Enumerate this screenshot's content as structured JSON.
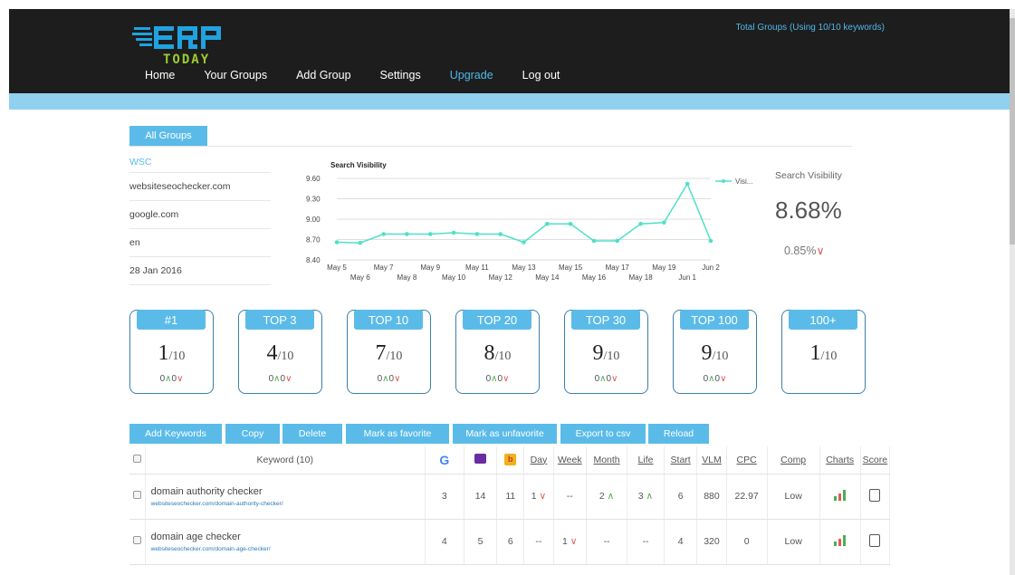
{
  "header": {
    "total_groups": "Total Groups (Using 10/10 keywords)",
    "nav": [
      "Home",
      "Your Groups",
      "Add Group",
      "Settings",
      "Upgrade",
      "Log out"
    ]
  },
  "logo": {
    "text_top": "ERP",
    "text_bottom": "TODAY",
    "brand_color": "#1fa3e0",
    "accent_color": "#9acd32"
  },
  "tabs": {
    "all_groups": "All Groups"
  },
  "group_info": {
    "name": "WSC",
    "domain": "websiteseochecker.com",
    "engine": "google.com",
    "language": "en",
    "date": "28 Jan 2016"
  },
  "chart_data": {
    "type": "line",
    "title": "Search Visibility",
    "legend": "Visi...",
    "ylim": [
      8.4,
      9.6
    ],
    "yticks": [
      "9.60",
      "9.30",
      "9.00",
      "8.70",
      "8.40"
    ],
    "x": [
      "May 5",
      "May 6",
      "May 7",
      "May 8",
      "May 9",
      "May 10",
      "May 11",
      "May 12",
      "May 13",
      "May 14",
      "May 15",
      "May 16",
      "May 17",
      "May 18",
      "May 19",
      "Jun 1",
      "Jun 2"
    ],
    "series": [
      {
        "name": "Visi...",
        "values": [
          8.66,
          8.65,
          8.78,
          8.78,
          8.78,
          8.8,
          8.78,
          8.78,
          8.66,
          8.93,
          8.93,
          8.68,
          8.68,
          8.93,
          8.95,
          9.52,
          8.68
        ]
      }
    ],
    "color": "#4fe0c8",
    "legend_position": "top-right"
  },
  "visibility": {
    "label": "Search Visibility",
    "value": "8.68%",
    "delta": "0.85%",
    "delta_arrow": "∨"
  },
  "cards": [
    {
      "title": "#1",
      "value": "1",
      "total": "/10",
      "up": "0",
      "down": "0"
    },
    {
      "title": "TOP 3",
      "value": "4",
      "total": "/10",
      "up": "0",
      "down": "0"
    },
    {
      "title": "TOP 10",
      "value": "7",
      "total": "/10",
      "up": "0",
      "down": "0"
    },
    {
      "title": "TOP 20",
      "value": "8",
      "total": "/10",
      "up": "0",
      "down": "0"
    },
    {
      "title": "TOP 30",
      "value": "9",
      "total": "/10",
      "up": "0",
      "down": "0"
    },
    {
      "title": "TOP 100",
      "value": "9",
      "total": "/10",
      "up": "0",
      "down": "0"
    },
    {
      "title": "100+",
      "value": "1",
      "total": "/10",
      "up": "",
      "down": ""
    }
  ],
  "toolbar": [
    "Add Keywords",
    "Copy",
    "Delete",
    "Mark as favorite",
    "Mark as unfavorite",
    "Export to csv",
    "Reload"
  ],
  "table": {
    "headers": {
      "keyword": "Keyword (10)",
      "day": "Day",
      "week": "Week",
      "month": "Month",
      "life": "Life",
      "start": "Start",
      "vlm": "VLM",
      "cpc": "CPC",
      "comp": "Comp",
      "charts": "Charts",
      "score": "Score"
    },
    "rows": [
      {
        "keyword": "domain authority checker",
        "url": "websiteseochecker.com/domain-authority-checker/",
        "g": "3",
        "y": "14",
        "b": "11",
        "day": "1",
        "week": "--",
        "month": "2",
        "life": "3",
        "start": "6",
        "vlm": "880",
        "cpc": "22.97",
        "comp": "Low"
      },
      {
        "keyword": "domain age checker",
        "url": "websiteseochecker.com/domain-age-checker/",
        "g": "4",
        "y": "5",
        "b": "6",
        "day": "--",
        "week": "1",
        "month": "--",
        "life": "--",
        "start": "4",
        "vlm": "320",
        "cpc": "0",
        "comp": "Low"
      }
    ]
  }
}
